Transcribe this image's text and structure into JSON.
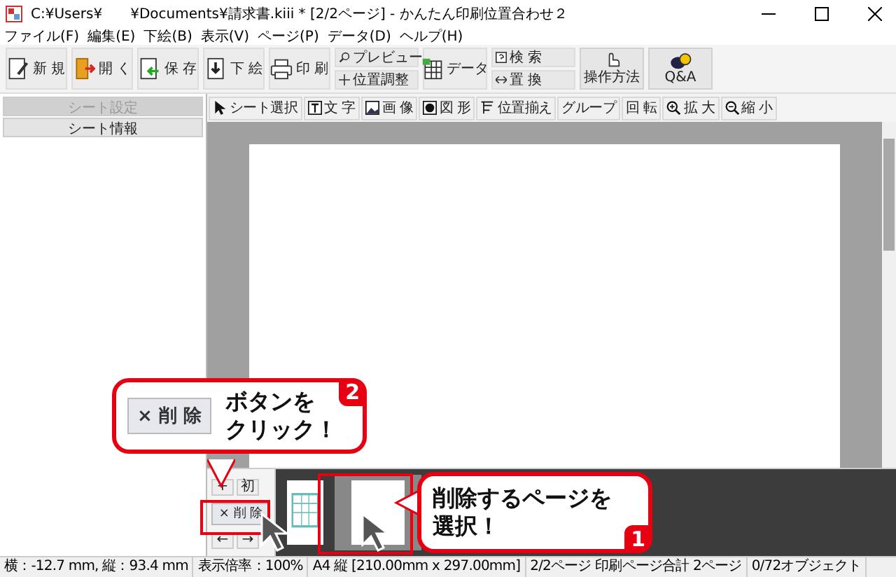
{
  "window": {
    "title": "C:¥Users¥　　¥Documents¥請求書.kiii * [2/2ページ] - かんたん印刷位置合わせ２"
  },
  "menu": [
    "ファイル(F)",
    "編集(E)",
    "下絵(B)",
    "表示(V)",
    "ページ(P)",
    "データ(D)",
    "ヘルプ(H)"
  ],
  "toolbar": [
    {
      "kind": "button",
      "label": "新 規"
    },
    {
      "kind": "button",
      "label": "開 く"
    },
    {
      "kind": "button",
      "label": "保 存"
    },
    {
      "kind": "button",
      "label": "下 絵"
    },
    {
      "kind": "button",
      "label": "印 刷"
    },
    {
      "kind": "stack",
      "items": [
        "プレビュー",
        "位置調整"
      ]
    },
    {
      "kind": "button",
      "label": "データ"
    },
    {
      "kind": "stack",
      "items": [
        "検 索",
        "置 換"
      ]
    },
    {
      "kind": "tall",
      "label": "操作方法"
    },
    {
      "kind": "tall",
      "label": "Q&A"
    }
  ],
  "sidebar": {
    "tabs": [
      {
        "label": "シート設定",
        "disabled": true
      },
      {
        "label": "シート情報",
        "disabled": false
      }
    ]
  },
  "tools": [
    "シート選択",
    "文 字",
    "画 像",
    "図 形",
    "位置揃え",
    "グループ",
    "回 転",
    "拡 大",
    "縮 小"
  ],
  "page_strip": {
    "controls": [
      "+",
      "初"
    ],
    "delete_button": "× 削 除",
    "arrows": [
      "←",
      "→"
    ],
    "pages": [
      {
        "selected": false
      },
      {
        "selected": true
      }
    ]
  },
  "status_bar": [
    "横：-12.7 mm, 縦：93.4 mm",
    "表示倍率：100%",
    "A4 縦 [210.00mm x 297.00mm]",
    "2/2ページ 印刷ページ合計 2ページ",
    "0/72オブジェクト"
  ],
  "callouts": [
    {
      "kind": "button",
      "button_label": "× 削 除",
      "lines": [
        "ボタンを",
        "クリック！"
      ],
      "badge": "2"
    },
    {
      "kind": "plain",
      "lines": [
        "削除するページを",
        "選択！"
      ],
      "badge": "1"
    }
  ]
}
